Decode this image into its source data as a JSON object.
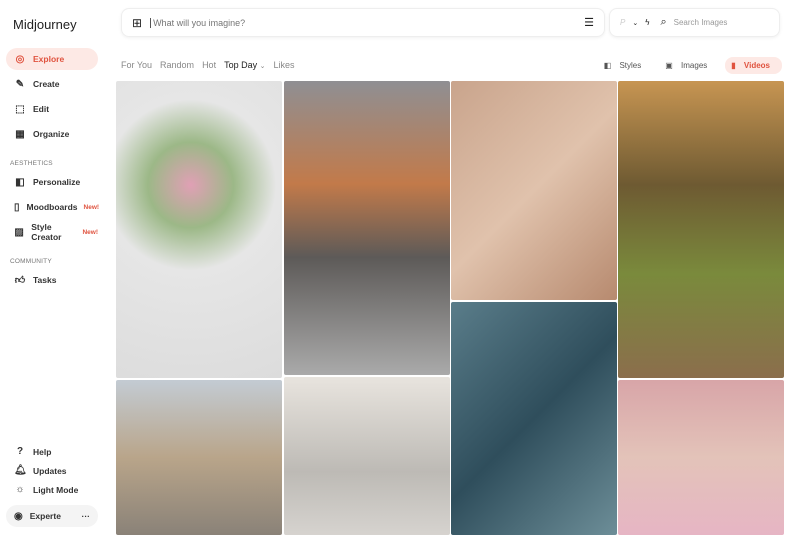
{
  "brand": "Midjourney",
  "nav": [
    {
      "label": "Explore",
      "icon": "compass-icon"
    },
    {
      "label": "Create",
      "icon": "brush-icon"
    },
    {
      "label": "Edit",
      "icon": "edit-icon"
    },
    {
      "label": "Organize",
      "icon": "grid-icon"
    }
  ],
  "aesthetics_label": "AESTHETICS",
  "aesthetics": [
    {
      "label": "Personalize"
    },
    {
      "label": "Moodboards",
      "badge": "New!"
    },
    {
      "label": "Style Creator",
      "badge": "New!"
    }
  ],
  "community_label": "COMMUNITY",
  "community": [
    {
      "label": "Tasks"
    }
  ],
  "bottom": [
    {
      "label": "Help"
    },
    {
      "label": "Updates"
    },
    {
      "label": "Light Mode"
    }
  ],
  "user": {
    "name": "Experte",
    "more": "···"
  },
  "search": {
    "placeholder": "What will you imagine?",
    "images_placeholder": "Search Images",
    "p": "P"
  },
  "tabs": [
    "For You",
    "Random",
    "Hot",
    "Top Day",
    "Likes"
  ],
  "views": [
    "Styles",
    "Images",
    "Videos"
  ],
  "accent": "#e0533f"
}
